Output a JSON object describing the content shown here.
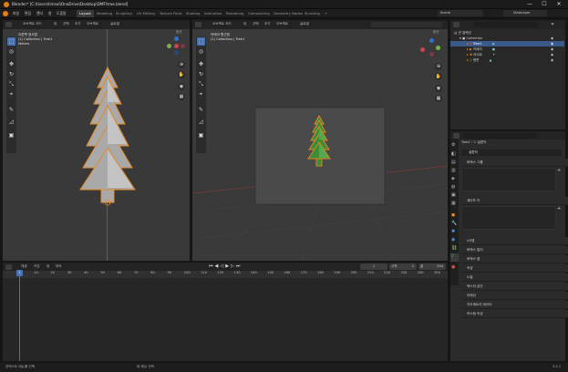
{
  "window": {
    "title": "Blender* [C:\\Users\\limsol\\OneDrive\\Desktop\\DMF\\tree.blend]",
    "minimize": "—",
    "maximize": "☐",
    "close": "✕"
  },
  "menu": {
    "items": [
      "파일",
      "편집",
      "렌더",
      "창",
      "도움말"
    ]
  },
  "workspaces": {
    "tabs": [
      "Layout",
      "Modeling",
      "Sculpting",
      "UV Editing",
      "Texture Paint",
      "Shading",
      "Animation",
      "Rendering",
      "Compositing",
      "Geometry Nodes",
      "Scripting",
      "+"
    ]
  },
  "topright": {
    "scene": "Scene",
    "viewlayer": "ViewLayer"
  },
  "left_viewport": {
    "header": [
      "오브젝트 모드",
      "뷰",
      "선택",
      "추가",
      "오브젝트",
      "글로벌"
    ],
    "overlay": [
      "오른쪽 정사법",
      "(1) Collection | Tree1",
      "Meters"
    ],
    "options": "옵션"
  },
  "right_viewport": {
    "header": [
      "오브젝트 모드",
      "뷰",
      "선택",
      "추가",
      "오브젝트",
      "글로벌"
    ],
    "overlay": [
      "카메라 원근법",
      "(1) Collection | Tree1"
    ],
    "options": "옵션"
  },
  "outliner": {
    "title": "씬 컬렉션",
    "collection": "Collection",
    "rows": [
      {
        "name": "Tree1",
        "selected": true
      },
      {
        "name": "카메라",
        "selected": false
      },
      {
        "name": "라이트",
        "selected": false
      },
      {
        "name": "평면",
        "selected": false
      }
    ]
  },
  "properties": {
    "search_placeholder": "",
    "crumbs": [
      "Tree1",
      "설편직"
    ],
    "material_slot": "설편직",
    "sections_top": [
      "버텍스 그룹",
      "셰이프 키"
    ],
    "sections": [
      "UV맵",
      "버텍스 컬러",
      "버텍스 맵",
      "속성",
      "노멀",
      "텍스처 공간",
      "리메쉬",
      "지오메트리 데이터",
      "커스텀 속성"
    ]
  },
  "timeline": {
    "header": [
      "재생",
      "키잉",
      "뷰",
      "마커"
    ],
    "current_frame": "1",
    "start_label": "시작",
    "start": "1",
    "end_label": "끝",
    "end": "250",
    "ticks": [
      "0",
      "10",
      "20",
      "30",
      "40",
      "50",
      "60",
      "70",
      "80",
      "90",
      "100",
      "110",
      "120",
      "130",
      "140",
      "150",
      "160",
      "170",
      "180",
      "190",
      "200",
      "210",
      "220",
      "230",
      "240",
      "250"
    ],
    "playhead": "1"
  },
  "statusbar": {
    "left": "컨텍스트 메뉴를 선택",
    "middle": "뷰 패닝 선택",
    "right": "3.4.1"
  },
  "colors": {
    "accent": "#4772b3",
    "orange": "#e87d0d",
    "tree_green": "#3d8c3a"
  }
}
